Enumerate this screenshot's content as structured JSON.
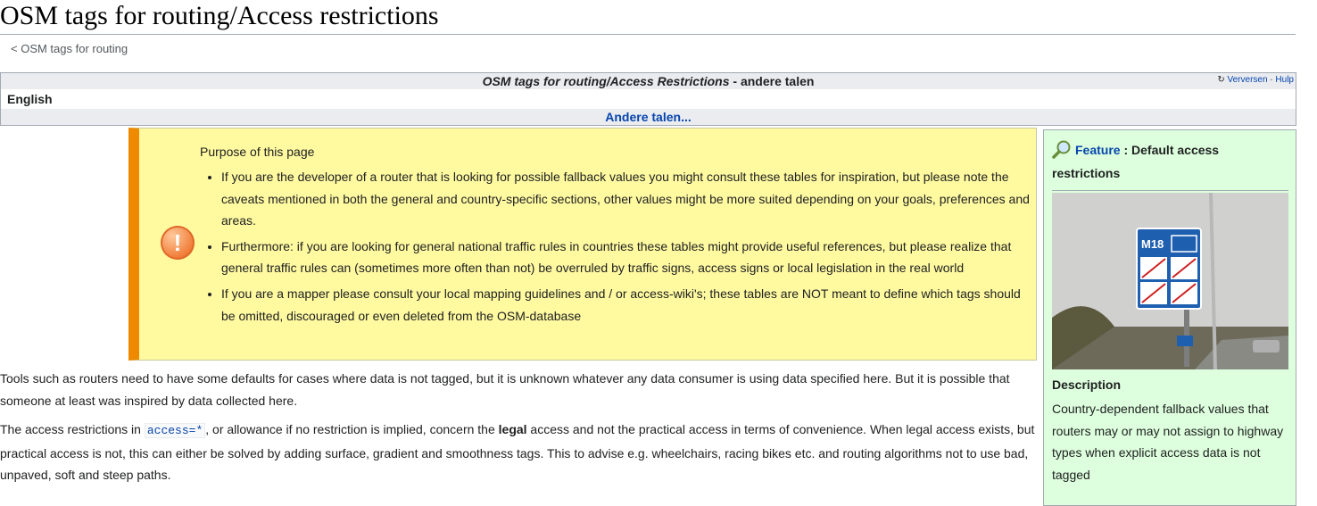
{
  "page": {
    "title": "OSM tags for routing/Access restrictions",
    "breadcrumb": "< OSM tags for routing"
  },
  "languages_box": {
    "heading_italic": "OSM tags for routing/Access Restrictions",
    "heading_suffix": " - andere talen",
    "refresh_label": "Verversen",
    "separator": " · ",
    "help_label": "Hulp",
    "current_language": "English",
    "more_languages": "Andere talen..."
  },
  "notice": {
    "heading": "Purpose of this page",
    "icon": "exclamation-icon",
    "items": [
      "If you are the developer of a router that is looking for possible fallback values you might consult these tables for inspiration, but please note the caveats mentioned in both the general and country-specific sections, other values might be more suited depending on your goals, preferences and areas.",
      "Furthermore: if you are looking for general national traffic rules in countries these tables might provide useful references, but please realize that general traffic rules can (sometimes more often than not) be overruled by traffic signs, access signs or local legislation in the real world",
      "If you are a mapper please consult your local mapping guidelines and / or access-wiki's; these tables are NOT meant to define which tags should be omitted, discouraged or even deleted from the OSM-database"
    ]
  },
  "body": {
    "paragraph1": "Tools such as routers need to have some defaults for cases where data is not tagged, but it is unknown whatever any data consumer is using data specified here. But it is possible that someone at least was inspired by data collected here.",
    "p2_part1": "The access restrictions in ",
    "p2_code": "access=*",
    "p2_part2": ", or allowance if no restriction is implied, concern the ",
    "p2_bold": "legal",
    "p2_part3": " access and not the practical access in terms of convenience. When legal access exists, but practical access is not, this can either be solved by adding surface, gradient and smoothness tags. This to advise e.g. wheelchairs, racing bikes etc. and routing algorithms not to use bad, unpaved, soft and steep paths."
  },
  "infobox": {
    "feature_link": "Feature",
    "feature_sep": " : ",
    "feature_title": "Default access restrictions",
    "image_sign_label": "M18",
    "description_heading": "Description",
    "description": "Country-dependent fallback values that routers may or may not assign to highway types when explicit access data is not tagged",
    "colors": {
      "background": "#ddffdd",
      "sign_blue": "#1f5fb0"
    }
  }
}
